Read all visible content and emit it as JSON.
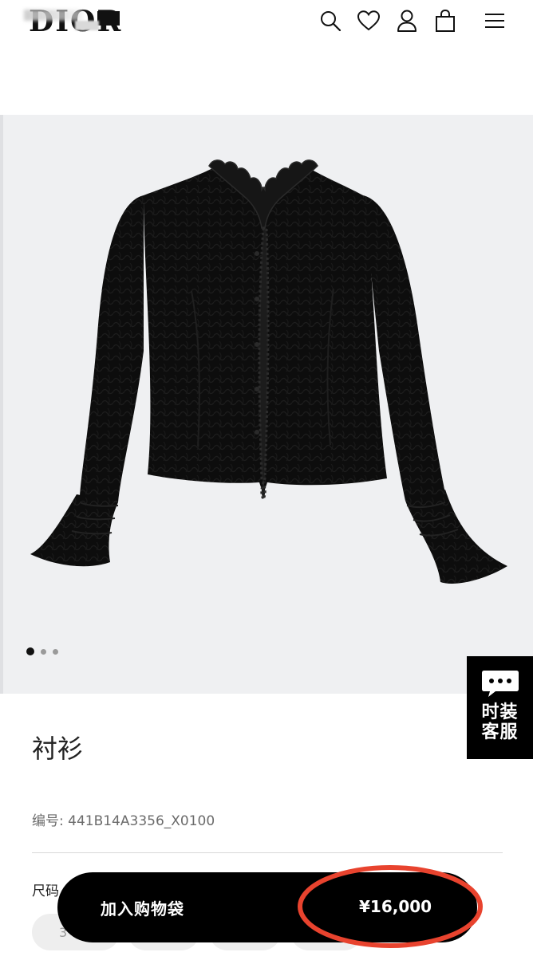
{
  "header": {
    "logo": "DIOR",
    "icons": [
      "search-icon",
      "heart-icon",
      "user-icon",
      "shopping-bag-icon",
      "menu-icon"
    ]
  },
  "gallery": {
    "image": "black ruffled lace blouse",
    "slide_count": 3,
    "active_slide": 1
  },
  "chat": {
    "line1": "时装",
    "line2": "客服"
  },
  "product": {
    "title": "衬衫",
    "sku": "编号: 441B14A3356_X0100",
    "size_label": "尺码",
    "size_partial": "3"
  },
  "buybar": {
    "add_to_bag": "加入购物袋",
    "price": "¥16,000"
  },
  "colors": {
    "accent": "#000000",
    "annotation": "#e8432e",
    "gallery_bg": "#eff0f2"
  }
}
